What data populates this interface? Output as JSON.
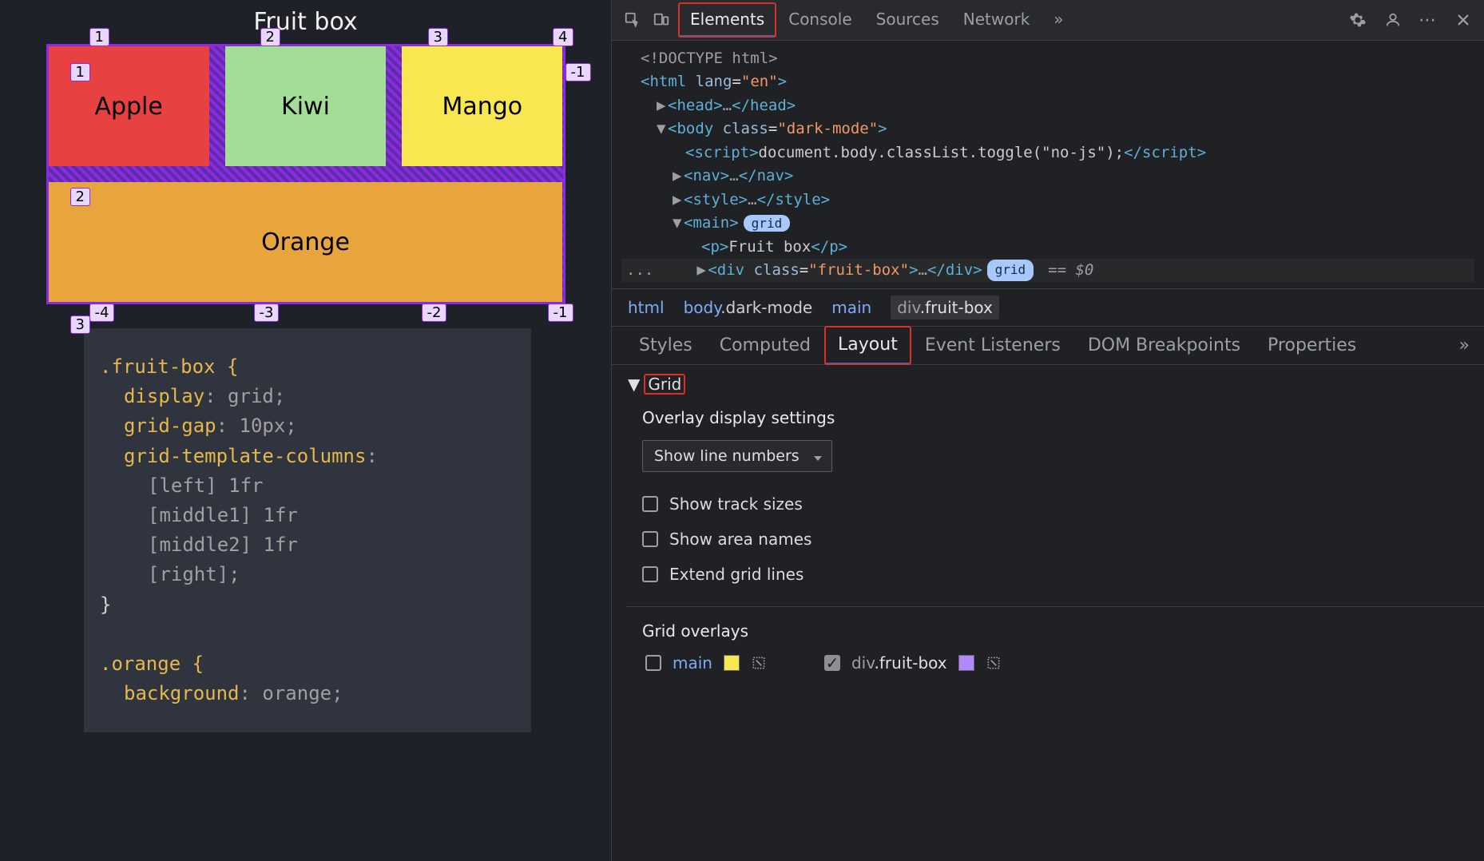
{
  "page": {
    "title": "Fruit box"
  },
  "fruits": {
    "apple": "Apple",
    "kiwi": "Kiwi",
    "mango": "Mango",
    "orange": "Orange"
  },
  "grid_lines": {
    "top": [
      "1",
      "2",
      "3",
      "4"
    ],
    "left": [
      "1",
      "2",
      "3"
    ],
    "bottom": [
      "-4",
      "-3",
      "-2",
      "-1"
    ],
    "right": [
      "-1",
      "-1"
    ]
  },
  "css": {
    "l1": ".fruit-box {",
    "l2a": "display",
    "l2b": ": grid;",
    "l3a": "grid-gap",
    "l3b": ": 10px;",
    "l4a": "grid-template-columns",
    "l4b": ":",
    "l5": "[left] 1fr",
    "l6": "[middle1] 1fr",
    "l7": "[middle2] 1fr",
    "l8": "[right];",
    "l9": "}",
    "l10": ".orange {",
    "l11a": "background",
    "l11b": ": orange;"
  },
  "devtools": {
    "main_tabs": [
      "Elements",
      "Console",
      "Sources",
      "Network"
    ],
    "overflow": "»",
    "dom": {
      "doctype": "<!DOCTYPE html>",
      "html_open": "html",
      "html_lang": "\"en\"",
      "head_open": "head",
      "ellipsis": "…",
      "head_close": "head",
      "body_open": "body",
      "body_class": "\"dark-mode\"",
      "script_open": "script",
      "script_body": "document.body.classList.toggle(\"no-js\");",
      "script_close": "script",
      "nav": "nav",
      "style": "style",
      "main": "main",
      "grid_badge": "grid",
      "p_open": "p",
      "p_text": "Fruit box",
      "p_close": "p",
      "div": "div",
      "div_class": "\"fruit-box\"",
      "sel_marker_left": "...",
      "sel_marker_right": "== $0"
    },
    "crumbs": {
      "html": "html",
      "body": {
        "tag": "body",
        "cls": ".dark-mode"
      },
      "main": "main",
      "sel": {
        "tag": "div",
        "cls": ".fruit-box"
      }
    },
    "style_tabs": [
      "Styles",
      "Computed",
      "Layout",
      "Event Listeners",
      "DOM Breakpoints",
      "Properties"
    ],
    "layout": {
      "section": "Grid",
      "overlay_heading": "Overlay display settings",
      "dropdown": "Show line numbers",
      "cb1": "Show track sizes",
      "cb2": "Show area names",
      "cb3": "Extend grid lines",
      "overlays_heading": "Grid overlays",
      "item1": "main",
      "item2": {
        "tag": "div",
        "cls": ".fruit-box"
      }
    }
  }
}
